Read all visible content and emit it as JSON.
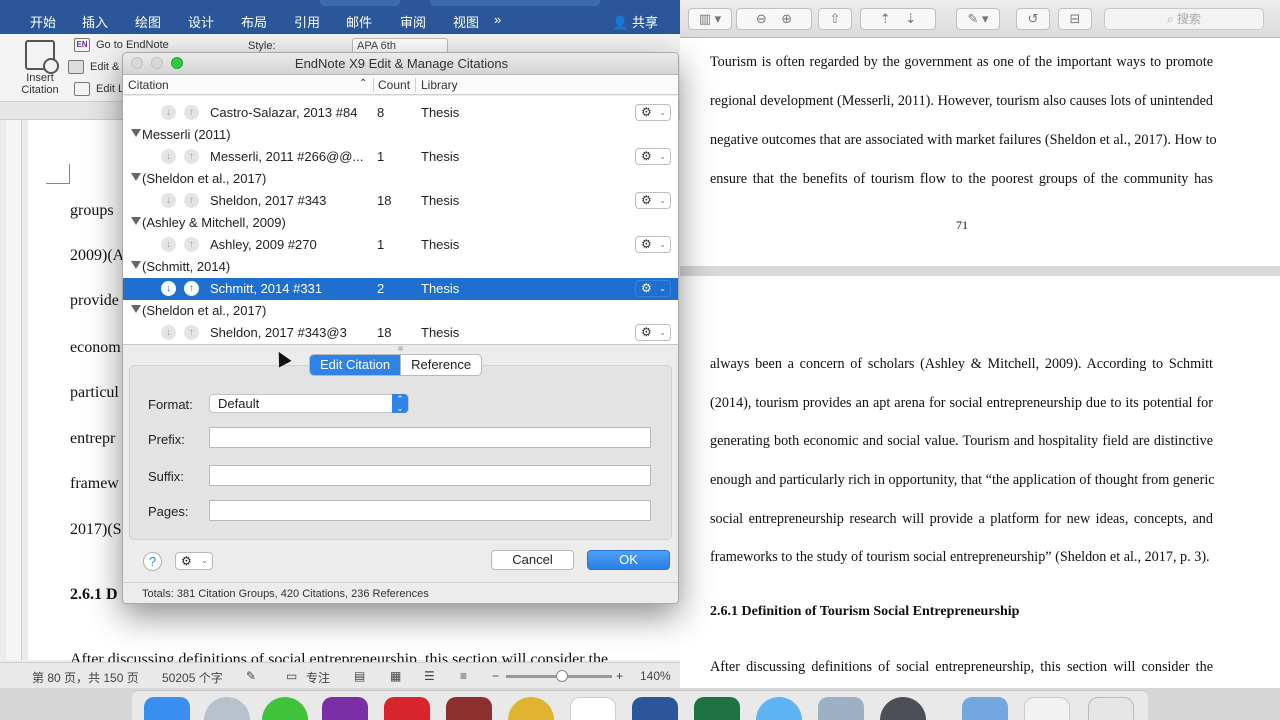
{
  "word": {
    "ribbon_tabs": [
      "开始",
      "插入",
      "绘图",
      "设计",
      "布局",
      "引用",
      "邮件",
      "审阅",
      "视图"
    ],
    "more_tabs": "»",
    "share_label": "共享",
    "insert_citation_label": "Insert Citation",
    "goto_endnote_label": "Go to EndNote",
    "edit_label": "Edit &",
    "edit_library_label": "Edit L",
    "style_label": "Style:",
    "style_value": "APA 6th",
    "page_text": [
      "groups",
      "2009)(A",
      "provide",
      "econom",
      "particul",
      "entrepr",
      "framew",
      "2017)(S",
      "2.6.1 D",
      "After  discussing  definitions  of  social  entrepreneurship,  this  section  will  consider  the"
    ],
    "status": {
      "page_info": "第 80 页，共 150 页",
      "word_count": "50205 个字",
      "focus": "专注",
      "zoom": "140%"
    }
  },
  "preview": {
    "search_placeholder": "搜索",
    "page1_lines": [
      "Tourism is often regarded by the government as one of the important ways to promote",
      "regional development (Messerli, 2011). However, tourism also causes lots of unintended",
      "negative outcomes that are associated with market failures (Sheldon et al., 2017). How to",
      "ensure that the benefits of tourism flow to the poorest groups of the community has"
    ],
    "page_number": "71",
    "page2_lines": [
      "always been a concern of scholars (Ashley & Mitchell, 2009). According to Schmitt",
      "(2014), tourism provides an apt arena for social entrepreneurship due to its potential for",
      "generating both economic and social value. Tourism and hospitality field are distinctive",
      "enough and particularly rich in opportunity, that “the application of thought from generic",
      "social entrepreneurship research will provide a platform for new ideas, concepts, and",
      "frameworks to the study of tourism social entrepreneurship” (Sheldon et al., 2017, p. 3)."
    ],
    "heading": "2.6.1 Definition of Tourism Social Entrepreneurship",
    "last_line": "After discussing definitions of social entrepreneurship, this section will consider the"
  },
  "dialog": {
    "title": "EndNote X9 Edit & Manage Citations",
    "columns": {
      "citation": "Citation",
      "count": "Count",
      "library": "Library"
    },
    "groups": [
      {
        "label": "",
        "items": [
          {
            "citation": "Castro-Salazar, 2013 #84",
            "count": "8",
            "library": "Thesis"
          }
        ]
      },
      {
        "label": "Messerli (2011)",
        "items": [
          {
            "citation": "Messerli, 2011 #266@@...",
            "count": "1",
            "library": "Thesis"
          }
        ]
      },
      {
        "label": "(Sheldon et al., 2017)",
        "items": [
          {
            "citation": "Sheldon, 2017 #343",
            "count": "18",
            "library": "Thesis"
          }
        ]
      },
      {
        "label": "(Ashley & Mitchell, 2009)",
        "items": [
          {
            "citation": "Ashley, 2009 #270",
            "count": "1",
            "library": "Thesis"
          }
        ]
      },
      {
        "label": "(Schmitt, 2014)",
        "items": [
          {
            "citation": "Schmitt, 2014 #331",
            "count": "2",
            "library": "Thesis"
          }
        ]
      },
      {
        "label": "(Sheldon et al., 2017)",
        "items": [
          {
            "citation": "Sheldon, 2017 #343@3",
            "count": "18",
            "library": "Thesis"
          }
        ]
      }
    ],
    "tabs": {
      "edit_citation": "Edit Citation",
      "reference": "Reference"
    },
    "form": {
      "format_label": "Format:",
      "format_value": "Default",
      "prefix_label": "Prefix:",
      "prefix_value": "",
      "suffix_label": "Suffix:",
      "suffix_value": "",
      "pages_label": "Pages:",
      "pages_value": ""
    },
    "help_label": "?",
    "cancel_label": "Cancel",
    "ok_label": "OK",
    "totals": "Totals: 381 Citation Groups, 420 Citations, 236 References"
  },
  "colors": {
    "word_ribbon": "#2b579a",
    "selection": "#1f6fd1",
    "accent": "#2f82e6"
  }
}
